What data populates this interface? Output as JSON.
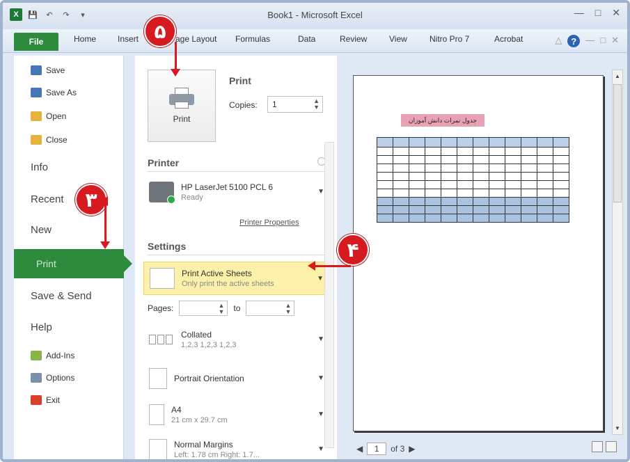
{
  "window": {
    "title": "Book1 - Microsoft Excel"
  },
  "ribbon": {
    "file_tab": "File",
    "tabs": [
      "Home",
      "Insert",
      "Page Layout",
      "Formulas",
      "Data",
      "Review",
      "View",
      "Nitro Pro 7",
      "Acrobat"
    ]
  },
  "backstage_nav": {
    "save": "Save",
    "save_as": "Save As",
    "open": "Open",
    "close": "Close",
    "info": "Info",
    "recent": "Recent",
    "new": "New",
    "print": "Print",
    "save_send": "Save & Send",
    "help": "Help",
    "add_ins": "Add-Ins",
    "options": "Options",
    "exit": "Exit"
  },
  "print_panel": {
    "print_button": "Print",
    "heading": "Print",
    "copies_label": "Copies:",
    "copies_value": "1",
    "printer_section": "Printer",
    "printer_name": "HP LaserJet 5100 PCL 6",
    "printer_status": "Ready",
    "printer_properties": "Printer Properties",
    "settings_section": "Settings",
    "active_sheets": "Print Active Sheets",
    "active_sheets_desc": "Only print the active sheets",
    "pages_label": "Pages:",
    "to_label": "to",
    "collated": "Collated",
    "collated_desc": "1,2,3  1,2,3  1,2,3",
    "orientation": "Portrait Orientation",
    "paper": "A4",
    "paper_desc": "21 cm x 29.7 cm",
    "margins": "Normal Margins",
    "margins_desc": "Left: 1.78 cm   Right: 1.7..."
  },
  "preview": {
    "sheet_title": "جدول نمرات دانش آموزان",
    "page_current": "1",
    "page_total": "of 3"
  },
  "callouts": {
    "step3": "۳",
    "step4": "۴",
    "step5": "۵"
  },
  "colors": {
    "file_green": "#2e8b3e",
    "callout_red": "#d71920",
    "highlight_yellow": "#fdf0a8"
  }
}
